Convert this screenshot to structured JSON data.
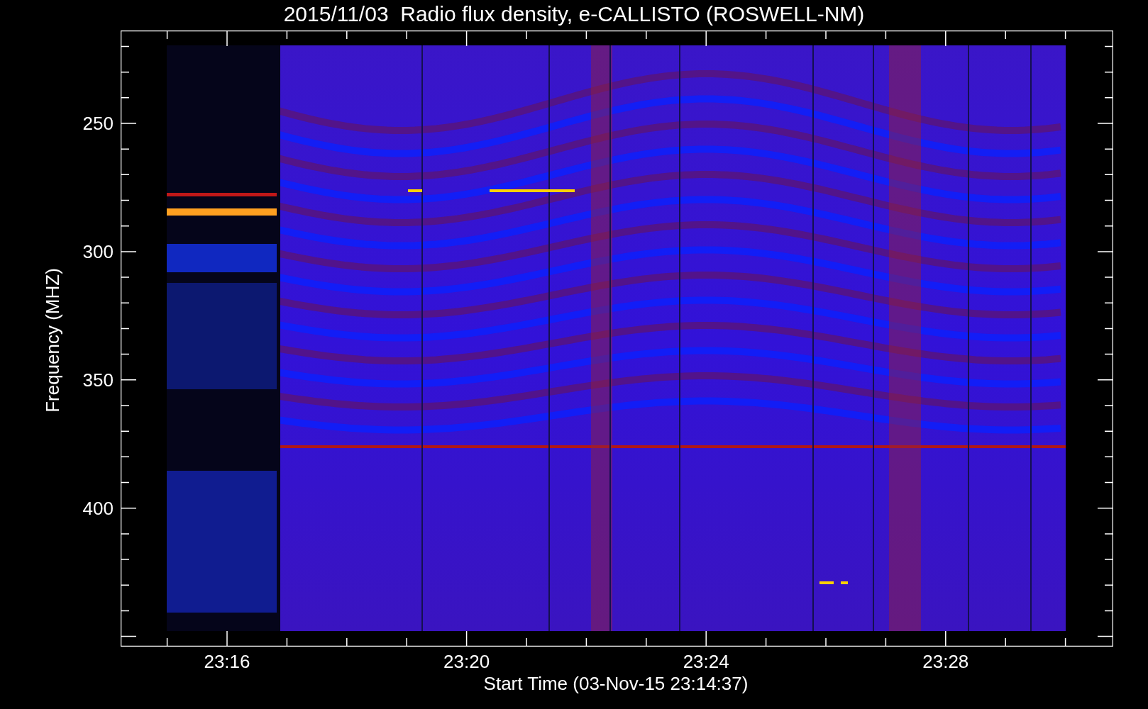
{
  "title": "2015/11/03  Radio flux density, e-CALLISTO (ROSWELL-NM)",
  "y_axis": {
    "label": "Frequency (MHZ)",
    "tick_labels": [
      "250",
      "300",
      "350",
      "400"
    ]
  },
  "x_axis": {
    "label": "Start Time (03-Nov-15 23:14:37)",
    "tick_labels": [
      "23:16",
      "23:20",
      "23:24",
      "23:28"
    ]
  }
}
